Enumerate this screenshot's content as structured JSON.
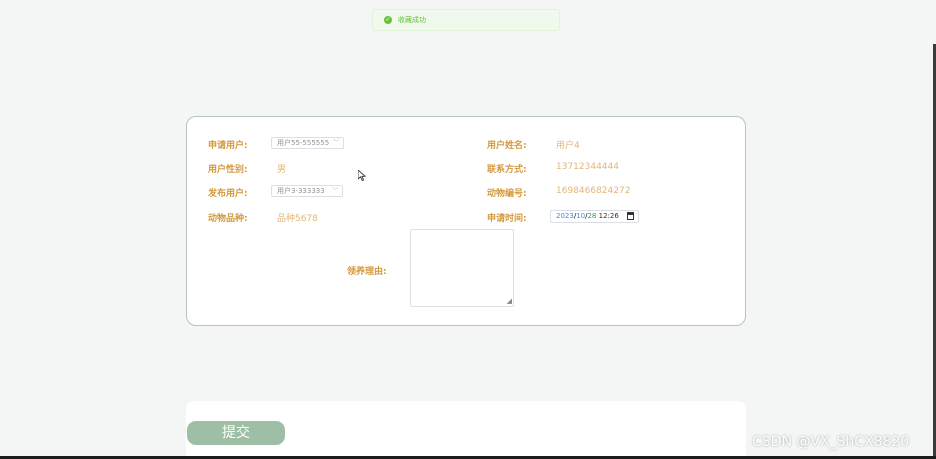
{
  "toast": {
    "message": "收藏成功",
    "icon": "check-circle-icon",
    "color": "#67c23a"
  },
  "form": {
    "applicant_user": {
      "label": "申请用户:",
      "value": "用户55-555555"
    },
    "user_name": {
      "label": "用户姓名:",
      "value": "用户4"
    },
    "user_gender": {
      "label": "用户性别:",
      "value": "男"
    },
    "contact": {
      "label": "联系方式:",
      "value": "13712344444"
    },
    "publisher_user": {
      "label": "发布用户:",
      "value": "用户3-333333"
    },
    "animal_id": {
      "label": "动物编号:",
      "value": "1698466824272"
    },
    "animal_breed": {
      "label": "动物品种:",
      "value": "品种5678"
    },
    "apply_time": {
      "label": "申请时间:",
      "year": "2023",
      "month": "10",
      "day": "28",
      "time": "12:26"
    },
    "adopt_reason": {
      "label": "领养理由:",
      "value": ""
    }
  },
  "submit_label": "提交",
  "watermark": "CSDN @VX_ShCX8820",
  "colors": {
    "label": "#d49a3e",
    "value": "#e2b678",
    "button": "#9ebfa6",
    "background": "#f3f6f5"
  }
}
